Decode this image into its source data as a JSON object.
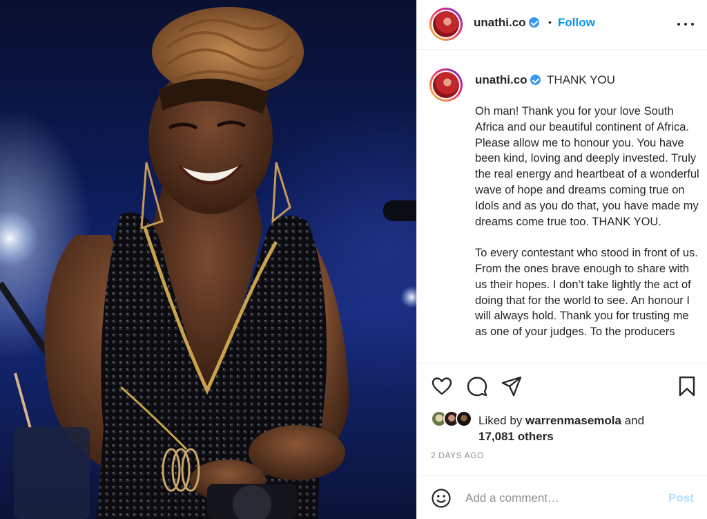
{
  "post": {
    "username": "unathi.co",
    "follow_label": "Follow",
    "dot": "•",
    "caption_title": "THANK YOU",
    "caption_paragraphs": [
      "Oh man! Thank you for your love South Africa and our beautiful continent of Africa. Please allow me to honour you. You have been kind, loving and deeply invested. Truly the real energy and heartbeat of a wonderful wave of hope and dreams coming true on Idols and as you do that, you have made my dreams come true too. THANK YOU.",
      "To every contestant who stood in front of us. From the ones brave enough to share with us their hopes. I don’t take lightly the act of doing that for the world to see. An honour I will always hold. Thank you for trusting me as one of your judges. To the producers"
    ],
    "liked_prefix": "Liked by ",
    "liked_user": "warrenmasemola",
    "liked_and": " and",
    "liked_others": "17,081 others",
    "timestamp": "2 DAYS AGO"
  },
  "comment": {
    "placeholder": "Add a comment…",
    "post_label": "Post"
  },
  "icons": {
    "heart": "heart-icon",
    "comment": "comment-icon",
    "share": "paper-plane-icon",
    "save": "bookmark-icon",
    "emoji": "smiley-icon",
    "more": "more-options-icon",
    "verified": "verified-badge-icon"
  },
  "colors": {
    "accent": "#0095f6",
    "verified": "#3897f0",
    "post_disabled": "#b2dffc",
    "muted": "#8e8e8e",
    "text": "#262626"
  }
}
